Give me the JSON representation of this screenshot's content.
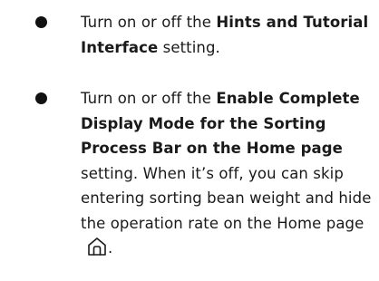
{
  "items": [
    {
      "prefix": "Turn on or off the ",
      "setting_name": "Hints and Tutorial Interface",
      "suffix": " setting."
    },
    {
      "prefix": "Turn on or off the ",
      "setting_name": "Enable Complete Display Mode for the Sorting Process Bar on the Home page",
      "suffix": " setting. When it’s off, you can skip entering sorting bean weight and hide the operation rate on the Home page",
      "end": ".",
      "icon": "home-icon"
    }
  ]
}
